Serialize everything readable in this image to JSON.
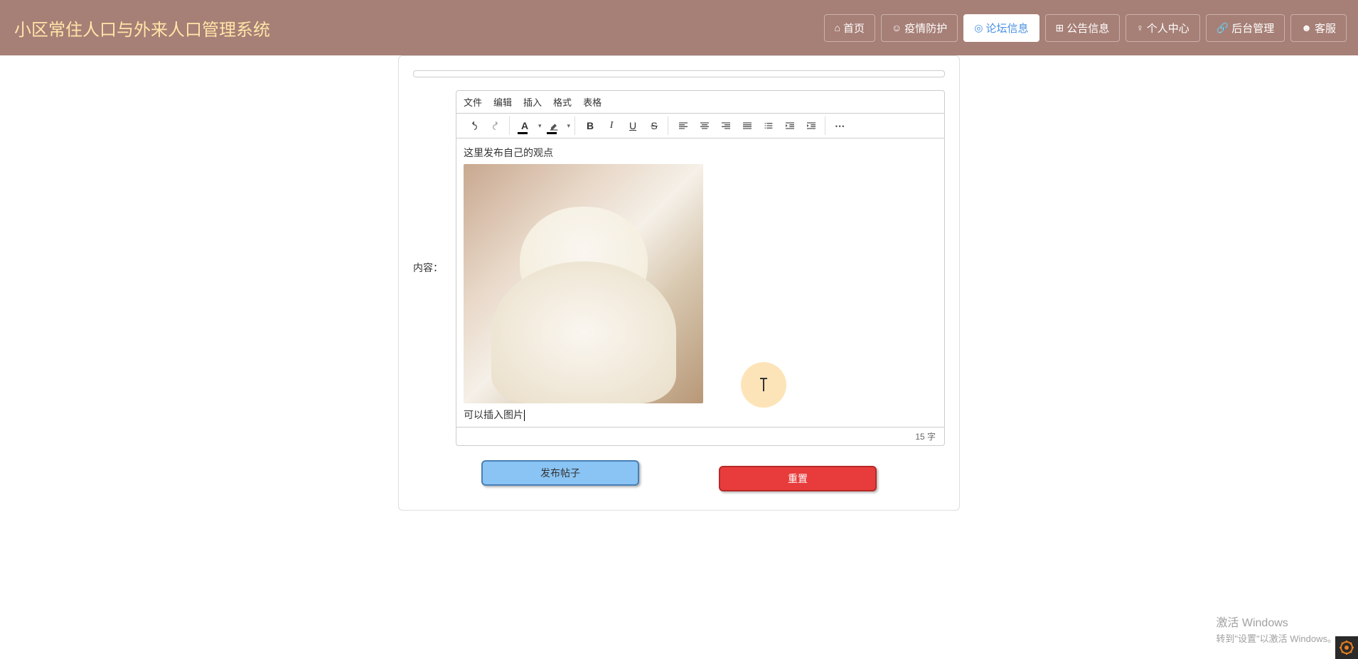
{
  "header": {
    "title": "小区常住人口与外来人口管理系统"
  },
  "nav": {
    "home": "首页",
    "epidemic": "疫情防护",
    "forum": "论坛信息",
    "announce": "公告信息",
    "personal": "个人中心",
    "backend": "后台管理",
    "service": "客服"
  },
  "form": {
    "content_label": "内容："
  },
  "editor": {
    "menu": {
      "file": "文件",
      "edit": "编辑",
      "insert": "插入",
      "format": "格式",
      "table": "表格"
    },
    "content_line1": "这里发布自己的观点",
    "content_line2": "可以插入图片",
    "word_count": "15 字"
  },
  "buttons": {
    "publish": "发布帖子",
    "reset": "重置"
  },
  "watermark": {
    "title": "激活 Windows",
    "subtitle": "转到\"设置\"以激活 Windows。"
  }
}
